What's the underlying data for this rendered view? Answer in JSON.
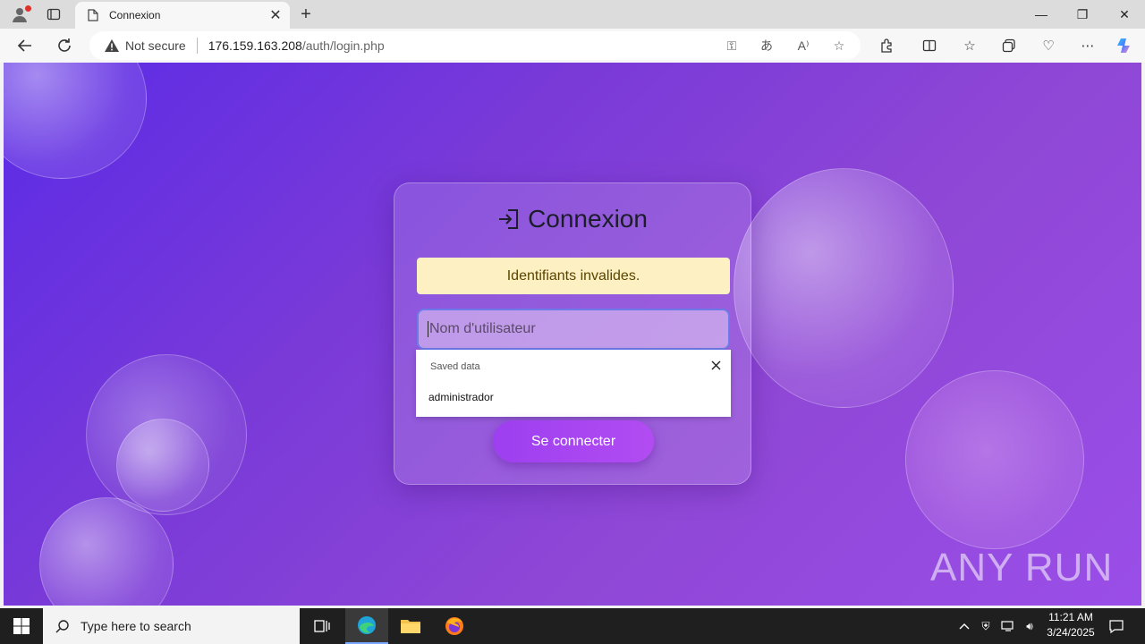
{
  "browser": {
    "tab_title": "Connexion",
    "address": {
      "security_label": "Not secure",
      "host": "176.159.163.208",
      "path": "/auth/login.php"
    }
  },
  "page": {
    "title": "Connexion",
    "alert_message": "Identifiants invalides.",
    "username_placeholder": "Nom d'utilisateur",
    "autofill": {
      "header": "Saved data",
      "items": [
        "administrador"
      ]
    },
    "submit_label": "Se connecter",
    "watermark": "ANY RUN"
  },
  "taskbar": {
    "search_placeholder": "Type here to search",
    "time": "11:21 AM",
    "date": "3/24/2025"
  },
  "colors": {
    "accent": "#9d3ff0",
    "alert_bg": "#fdf0c2",
    "page_gradient_start": "#5b2be6",
    "page_gradient_end": "#9a4ee8"
  }
}
